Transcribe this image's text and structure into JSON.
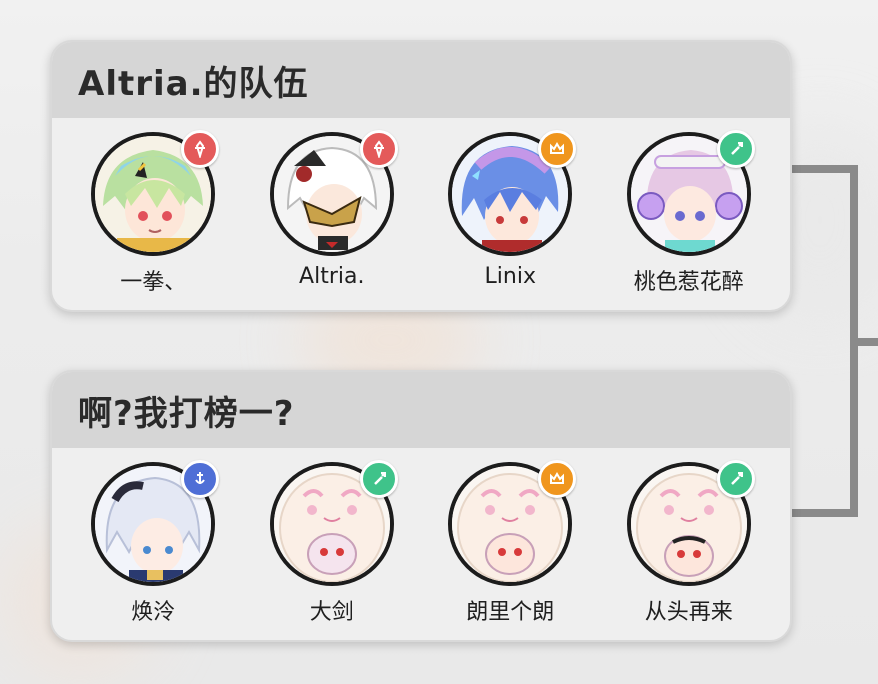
{
  "teams": [
    {
      "title": "Altria.的队伍",
      "members": [
        {
          "name": "一拳、",
          "role_icon": "assault-icon",
          "role_color": "#e45a5a"
        },
        {
          "name": "Altria.",
          "role_icon": "assault-icon",
          "role_color": "#e45a5a"
        },
        {
          "name": "Linix",
          "role_icon": "crown-icon",
          "role_color": "#f0961e"
        },
        {
          "name": "桃色惹花醉",
          "role_icon": "support-icon",
          "role_color": "#3fc38a"
        }
      ]
    },
    {
      "title": "啊?我打榜一?",
      "members": [
        {
          "name": "焕泠",
          "role_icon": "guard-icon",
          "role_color": "#4f6fd6"
        },
        {
          "name": "大剑",
          "role_icon": "support-icon",
          "role_color": "#3fc38a"
        },
        {
          "name": "朗里个朗",
          "role_icon": "crown-icon",
          "role_color": "#f0961e"
        },
        {
          "name": "从头再来",
          "role_icon": "support-icon",
          "role_color": "#3fc38a"
        }
      ]
    }
  ]
}
